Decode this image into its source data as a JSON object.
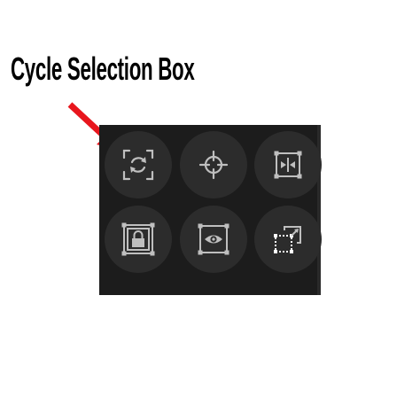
{
  "annotation": {
    "label": "Cycle Selection Box",
    "arrow_color": "#e8161d"
  },
  "toolbar": {
    "background": "#1c1c1c",
    "button_color": "#2c2c2c",
    "icon_color": "#bfbfbf",
    "buttons": [
      {
        "icon": "cycle-selection-icon"
      },
      {
        "icon": "crosshair-icon"
      },
      {
        "icon": "collapse-horizontal-icon"
      },
      {
        "icon": "lock-selection-icon"
      },
      {
        "icon": "eye-selection-icon"
      },
      {
        "icon": "transform-copy-icon"
      }
    ]
  }
}
